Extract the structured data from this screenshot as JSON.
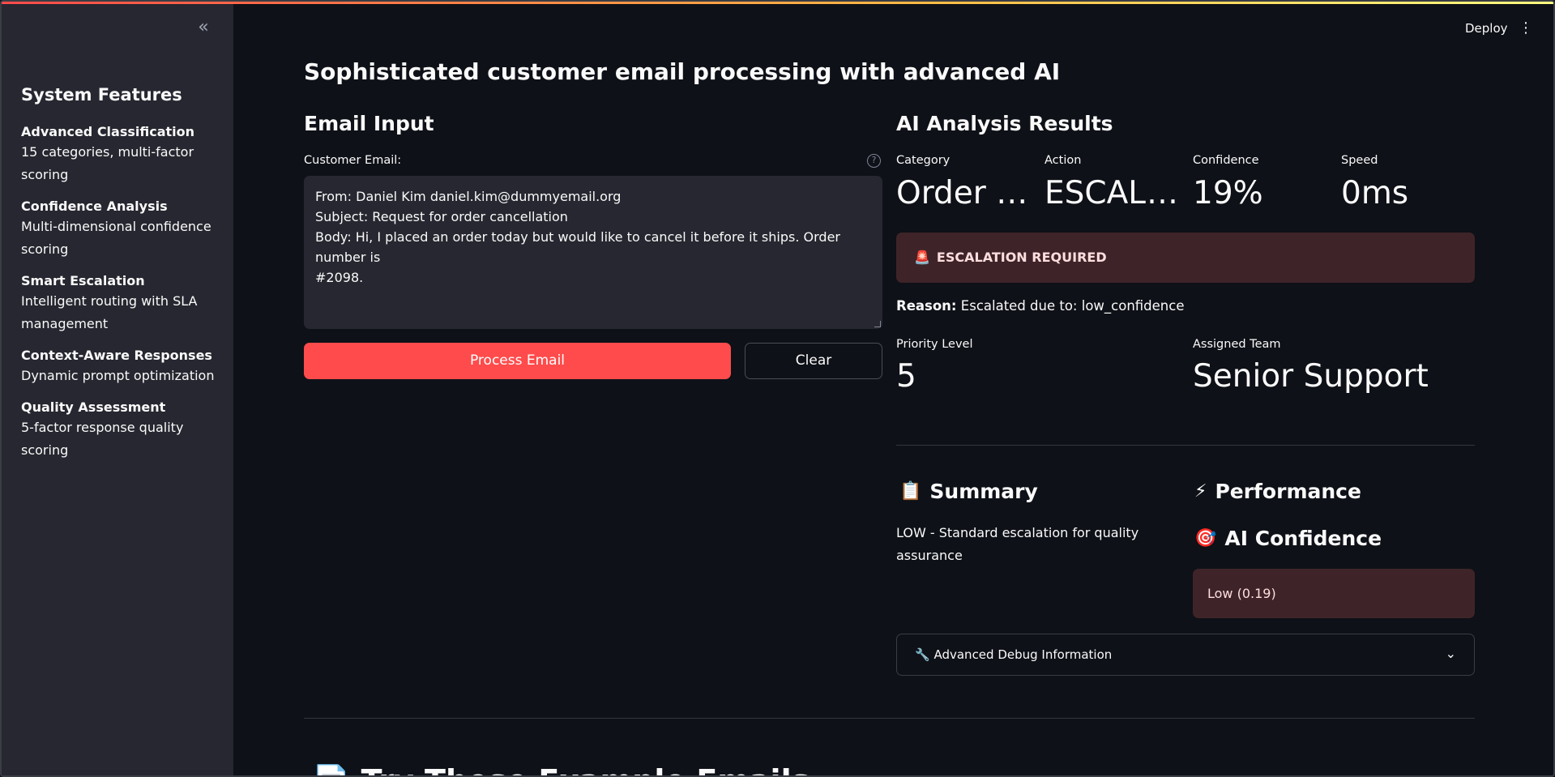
{
  "sidebar": {
    "collapse_label": "«",
    "title": "System Features",
    "features": [
      {
        "name": "Advanced Classification",
        "desc": "15 categories, multi-factor scoring"
      },
      {
        "name": "Confidence Analysis",
        "desc": "Multi-dimensional confidence scoring"
      },
      {
        "name": "Smart Escalation",
        "desc": "Intelligent routing with SLA management"
      },
      {
        "name": "Context-Aware Responses",
        "desc": "Dynamic prompt optimization"
      },
      {
        "name": "Quality Assessment",
        "desc": "5-factor response quality scoring"
      }
    ]
  },
  "header": {
    "deploy_label": "Deploy",
    "menu_label": "⋮"
  },
  "main": {
    "title": "Sophisticated customer email processing with advanced AI",
    "email_input": {
      "heading": "Email Input",
      "field_label": "Customer Email:",
      "help_icon": "?",
      "value_lines": [
        "From: Daniel Kim daniel.kim@dummyemail.org",
        "Subject: Request for order cancellation",
        "Body: Hi, I placed an order today but would like to cancel it before it ships. Order number is",
        "#2098."
      ],
      "process_label": "Process Email",
      "clear_label": "Clear"
    },
    "results": {
      "heading": "AI Analysis Results",
      "metrics": [
        {
          "label": "Category",
          "value": "Order S…"
        },
        {
          "label": "Action",
          "value": "ESCALA…"
        },
        {
          "label": "Confidence",
          "value": "19%"
        },
        {
          "label": "Speed",
          "value": "0ms"
        }
      ],
      "alert_icon": "🚨",
      "alert_text": "ESCALATION REQUIRED",
      "reason_label": "Reason:",
      "reason_text": "Escalated due to: low_confidence",
      "priority_label": "Priority Level",
      "priority_value": "5",
      "team_label": "Assigned Team",
      "team_value": "Senior Support",
      "summary_icon": "📋",
      "summary_heading": "Summary",
      "summary_text": "LOW - Standard escalation for quality assurance",
      "performance_icon": "⚡",
      "performance_heading": "Performance",
      "confidence_icon": "🎯",
      "confidence_heading": "AI Confidence",
      "confidence_value": "Low (0.19)",
      "debug_icon": "🔧",
      "debug_label": "Advanced Debug Information",
      "debug_chevron": "⌄"
    },
    "examples": {
      "icon": "📄",
      "heading": "Try These Example Emails"
    }
  },
  "colors": {
    "background": "#0e1117",
    "sidebar": "#262730",
    "primary": "#ff4b4b",
    "alert_bg": "#3e2428"
  }
}
